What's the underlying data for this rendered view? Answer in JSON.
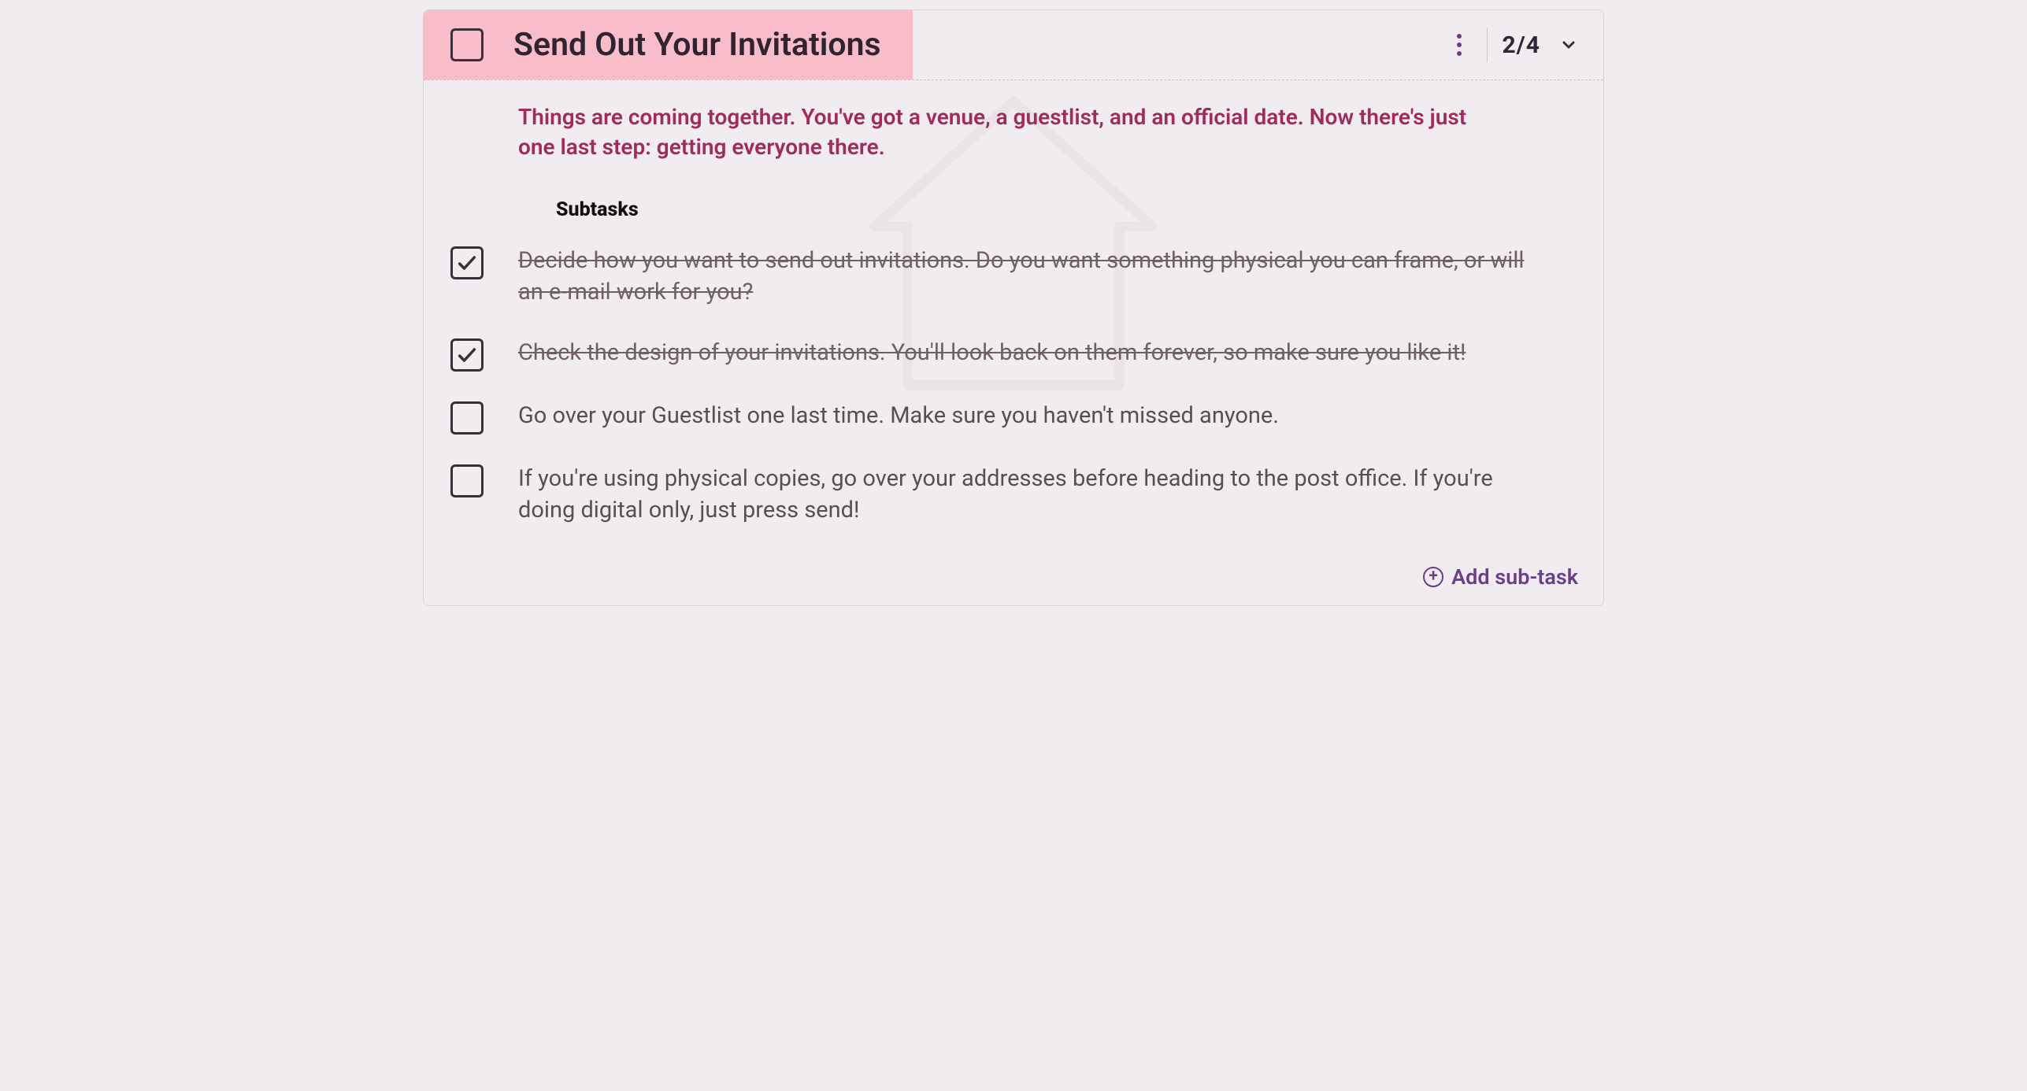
{
  "task": {
    "title": "Send Out Your Invitations",
    "completed": false,
    "description": "Things are coming together. You've got a venue, a guestlist, and an official date. Now there's just one last step: getting everyone there.",
    "progress": "2/4"
  },
  "subtasks_label": "Subtasks",
  "subtasks": [
    {
      "text": "Decide how you want to send out invitations. Do you want something physical you can frame, or will an e-mail work for you?",
      "done": true
    },
    {
      "text": "Check the design of your invitations. You'll look back on them forever, so make sure you like it!",
      "done": true
    },
    {
      "text": "Go over your Guestlist one last time. Make sure you haven't missed anyone.",
      "done": false
    },
    {
      "text": "If you're using physical copies, go over your addresses before heading to the post office. If you're doing digital only, just press send!",
      "done": false
    }
  ],
  "actions": {
    "add_subtask": "Add sub-task"
  }
}
